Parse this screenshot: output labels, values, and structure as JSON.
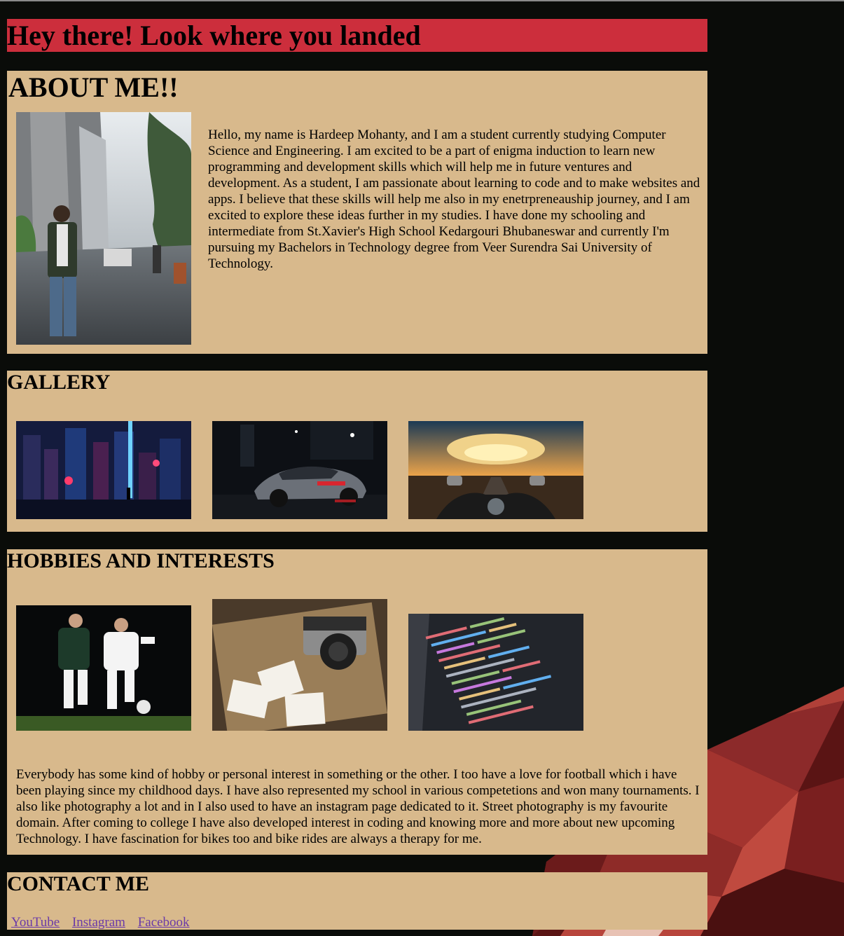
{
  "header": {
    "title": "Hey there! Look where you landed"
  },
  "about": {
    "heading": "ABOUT ME!!",
    "photo_icon": "portrait-photo",
    "text": "Hello, my name is Hardeep Mohanty, and I am a student currently studying Computer Science and Engineering. I am excited to be a part of enigma induction to learn new programming and development skills which will help me in future ventures and development. As a student, I am passionate about learning to code and to make websites and apps. I believe that these skills will help me also in my enetrpreneauship journey, and I am excited to explore these ideas further in my studies. I have done my schooling and intermediate from St.Xavier's High School Kedargouri Bhubaneswar and currently I'm pursuing my Bachelors in Technology degree from Veer Surendra Sai University of Technology."
  },
  "gallery": {
    "heading": "GALLERY",
    "images": [
      "cyberpunk-city-image",
      "sports-car-night-image",
      "motorbike-sunset-ride-image"
    ]
  },
  "hobbies": {
    "heading": "HOBBIES AND INTERESTS",
    "images": [
      "football-players-image",
      "camera-photos-map-image",
      "code-screen-image"
    ],
    "text": "Everybody has some kind of hobby or personal interest in something or the other. I too have a love for football which i have been playing since my childhood days. I have also represented my school in various competetions and won many tournaments. I also like photography a lot and in I also used to have an instagram page dedicated to it. Street photography is my favourite domain. After coming to college I have also developed interest in coding and knowing more and more about new upcoming Technology. I have fascination for bikes too and bike rides are always a therapy for me."
  },
  "contact": {
    "heading": "CONTACT ME",
    "links": [
      "YouTube",
      "Instagram",
      "Facebook"
    ]
  },
  "colors": {
    "header_bg": "#cc2e3c",
    "panel_bg": "#d8b98c",
    "page_bg": "#0a0c09",
    "link": "#6a3aa8"
  }
}
